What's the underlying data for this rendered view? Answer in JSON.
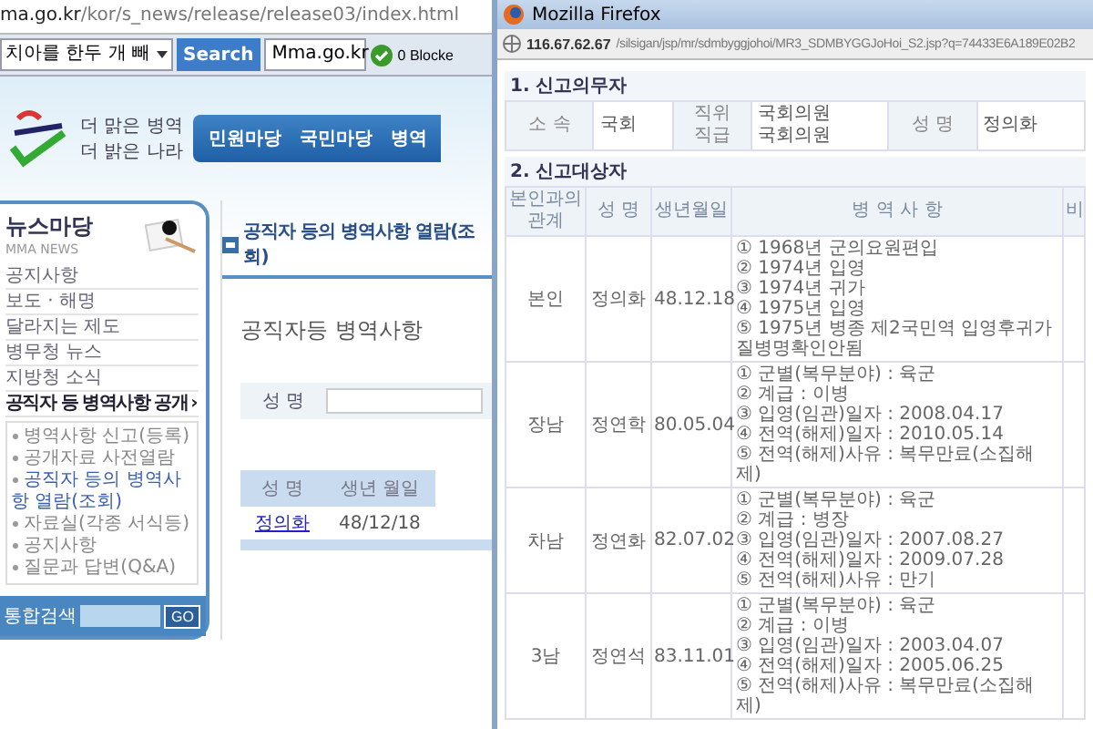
{
  "browser": {
    "address": {
      "host": "ma.go.kr",
      "path": "/kor/s_news/release/release03/index.html"
    },
    "toolbar": {
      "search_value": "치아를 한두 개 빼",
      "search_button": "Search",
      "site_field": "Mma.go.kr",
      "blocker": "0 Blocke"
    }
  },
  "site": {
    "slogan": [
      "더 맑은 병역",
      "더 밝은 나라"
    ],
    "nav": [
      "민원마당",
      "국민마당",
      "병역"
    ],
    "sidebar": {
      "title": "뉴스마당",
      "subtitle": "MMA NEWS",
      "items": [
        {
          "label": "공지사항",
          "selected": false
        },
        {
          "label": "보도 · 해명",
          "selected": false
        },
        {
          "label": "달라지는 제도",
          "selected": false
        },
        {
          "label": "병무청 뉴스",
          "selected": false
        },
        {
          "label": "지방청 소식",
          "selected": false
        },
        {
          "label": "공직자 등 병역사항 공개",
          "selected": true,
          "arrow": "›"
        }
      ],
      "subitems": [
        {
          "label": "병역사항 신고(등록)",
          "selected": false
        },
        {
          "label": "공개자료 사전열람",
          "selected": false
        },
        {
          "label": "공직자 등의 병역사항 열람(조회)",
          "selected": true
        },
        {
          "label": "자료실(각종 서식등)",
          "selected": false
        },
        {
          "label": "공지사항",
          "selected": false
        },
        {
          "label": "질문과 답변(Q&A)",
          "selected": false
        }
      ],
      "search_label": "통합검색",
      "search_button": "GO"
    },
    "main": {
      "title": "공직자 등의 병역사항 열람(조회)",
      "heading": "공직자등 병역사항",
      "form_label": "성 명",
      "result": {
        "columns": [
          "성 명",
          "생년 월일"
        ],
        "rows": [
          [
            "정의화",
            "48/12/18"
          ]
        ]
      }
    }
  },
  "popup": {
    "title": "Mozilla Firefox",
    "url_host": "116.67.62.67",
    "url_path": "/silsigan/jsp/mr/sdmbyggjohoi/MR3_SDMBYGGJoHoi_S2.jsp?q=74433E6A189E02B2",
    "section1": {
      "title": "1. 신고의무자",
      "cells": [
        {
          "kind": "label",
          "lines": [
            "소 속"
          ]
        },
        {
          "kind": "value",
          "lines": [
            "국회"
          ]
        },
        {
          "kind": "label",
          "lines": [
            "직위",
            "직급"
          ]
        },
        {
          "kind": "value",
          "lines": [
            "국회의원",
            "국회의원"
          ]
        },
        {
          "kind": "label",
          "lines": [
            "성 명"
          ]
        },
        {
          "kind": "value",
          "lines": [
            "정의화"
          ]
        }
      ]
    },
    "section2": {
      "title": "2. 신고대상자",
      "columns": [
        [
          "본인과의",
          "관계"
        ],
        [
          "성 명"
        ],
        [
          "생년월일"
        ],
        [
          "병 역 사 항"
        ],
        [
          "비"
        ]
      ],
      "rows": [
        {
          "relation": "본인",
          "name": "정의화",
          "birth": "48.12.18",
          "details": [
            "① 1968년 군의요원편입",
            "② 1974년 입영",
            "③ 1974년 귀가",
            "④ 1975년 입영",
            "⑤ 1975년 병종 제2국민역 입영후귀가 질병명확인안됨"
          ]
        },
        {
          "relation": "장남",
          "name": "정연학",
          "birth": "80.05.04",
          "details": [
            "① 군별(복무분야) : 육군",
            "② 계급 : 이병",
            "③ 입영(임관)일자 : 2008.04.17",
            "④ 전역(해제)일자 : 2010.05.14",
            "⑤ 전역(해제)사유 : 복무만료(소집해제)"
          ]
        },
        {
          "relation": "차남",
          "name": "정연화",
          "birth": "82.07.02",
          "details": [
            "① 군별(복무분야) : 육군",
            "② 계급 : 병장",
            "③ 입영(임관)일자 : 2007.08.27",
            "④ 전역(해제)일자 : 2009.07.28",
            "⑤ 전역(해제)사유 : 만기"
          ]
        },
        {
          "relation": "3남",
          "name": "정연석",
          "birth": "83.11.01",
          "details": [
            "① 군별(복무분야) : 육군",
            "② 계급 : 이병",
            "③ 입영(임관)일자 : 2003.04.07",
            "④ 전역(해제)일자 : 2005.06.25",
            "⑤ 전역(해제)사유 : 복무만료(소집해제)"
          ]
        }
      ]
    }
  }
}
